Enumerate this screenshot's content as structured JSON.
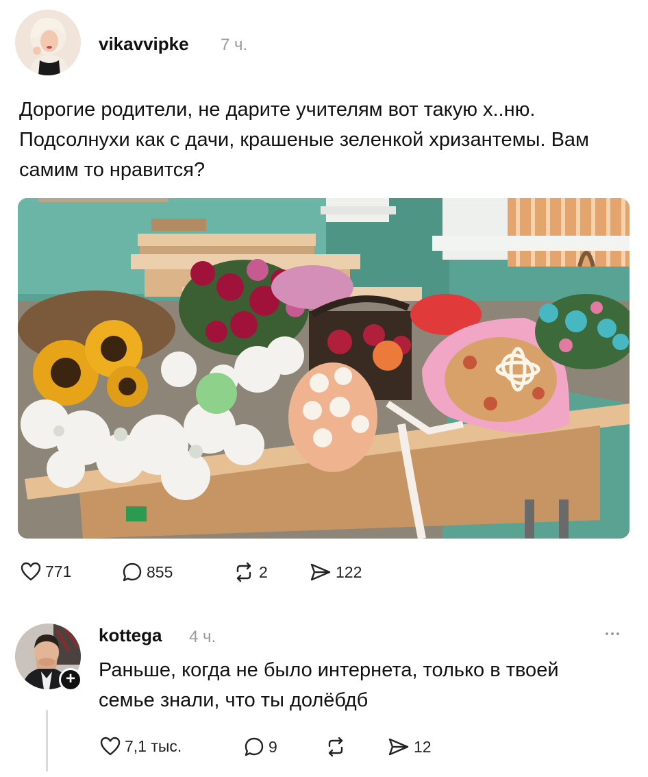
{
  "post": {
    "author": "vikavvipke",
    "time": "7 ч.",
    "text": "Дорогие родители, не дарите учителям вот такую х..ню. Подсолнухи как с дачи, крашеные зеленкой хризантемы. Вам самим то нравится?",
    "stats": {
      "likes": "771",
      "replies": "855",
      "reposts": "2",
      "shares": "122"
    }
  },
  "reply": {
    "author": "kottega",
    "time": "4 ч.",
    "text": "Раньше, когда не было интернета, только в твоей семье знали, что ты долёбдб",
    "follow_symbol": "+",
    "stats": {
      "likes": "7,1 тыс.",
      "replies": "9",
      "reposts": "",
      "shares": "12"
    }
  },
  "icons": {
    "like": "heart-icon",
    "reply": "speech-bubble-icon",
    "repost": "repost-arrows-icon",
    "share": "paper-plane-icon",
    "more": "ellipsis-icon"
  },
  "colors": {
    "text": "#111111",
    "muted": "#9a9a9a",
    "thread_line": "#d9d9d9"
  }
}
